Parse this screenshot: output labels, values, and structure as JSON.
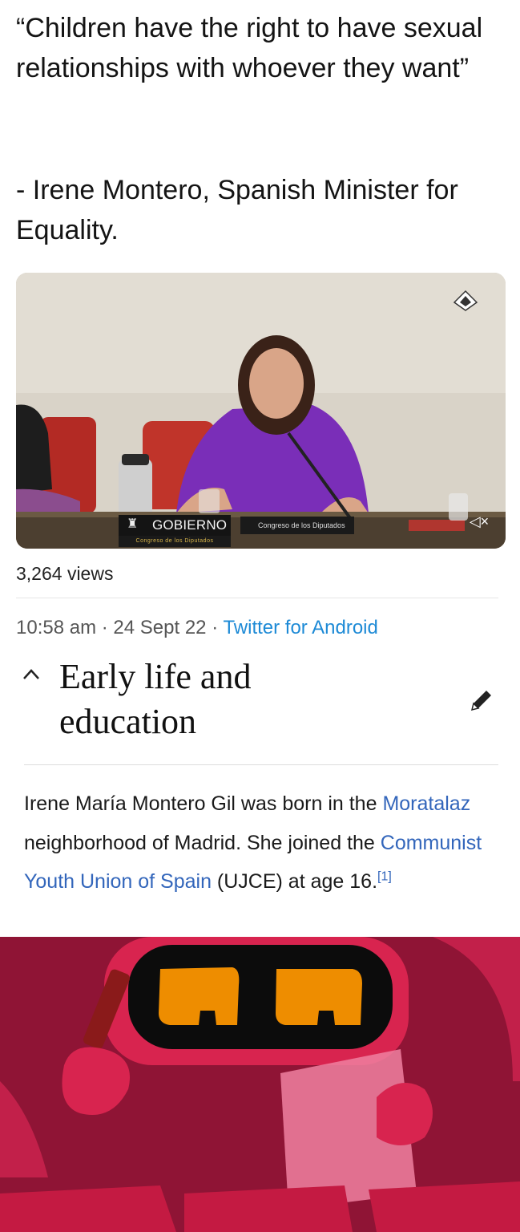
{
  "tweet": {
    "quote": "“Children have the right to have sexual relationships with whoever they want”",
    "attribution": "- Irene Montero, Spanish Minister for Equality.",
    "video": {
      "overlay_gov_label": "GOBIERNO",
      "overlay_congreso_label": "Congreso de los Diputados",
      "overlay_congreso_sub": "Congreso de los Diputados",
      "mute_icon": "speaker-muted-icon"
    },
    "views": "3,264 views",
    "time": "10:58 am",
    "date": "24 Sept 22",
    "separator": "·",
    "client": "Twitter for Android"
  },
  "wiki": {
    "section_title": "Early life and education",
    "collapse_icon": "chevron-up-icon",
    "edit_icon": "pencil-icon",
    "para_part1": "Irene María Montero Gil was born in the ",
    "link_moratalaz": "Moratalaz",
    "para_part2": " neighborhood of Madrid. She joined the ",
    "link_ujce": "Communist Youth Union of Spain",
    "para_part3": " (UJCE) at age 16.",
    "citation": "[1]"
  },
  "colors": {
    "link_twitter": "#1d8ad6",
    "link_wiki": "#3366bb",
    "cartoon_red": "#b3163f"
  }
}
